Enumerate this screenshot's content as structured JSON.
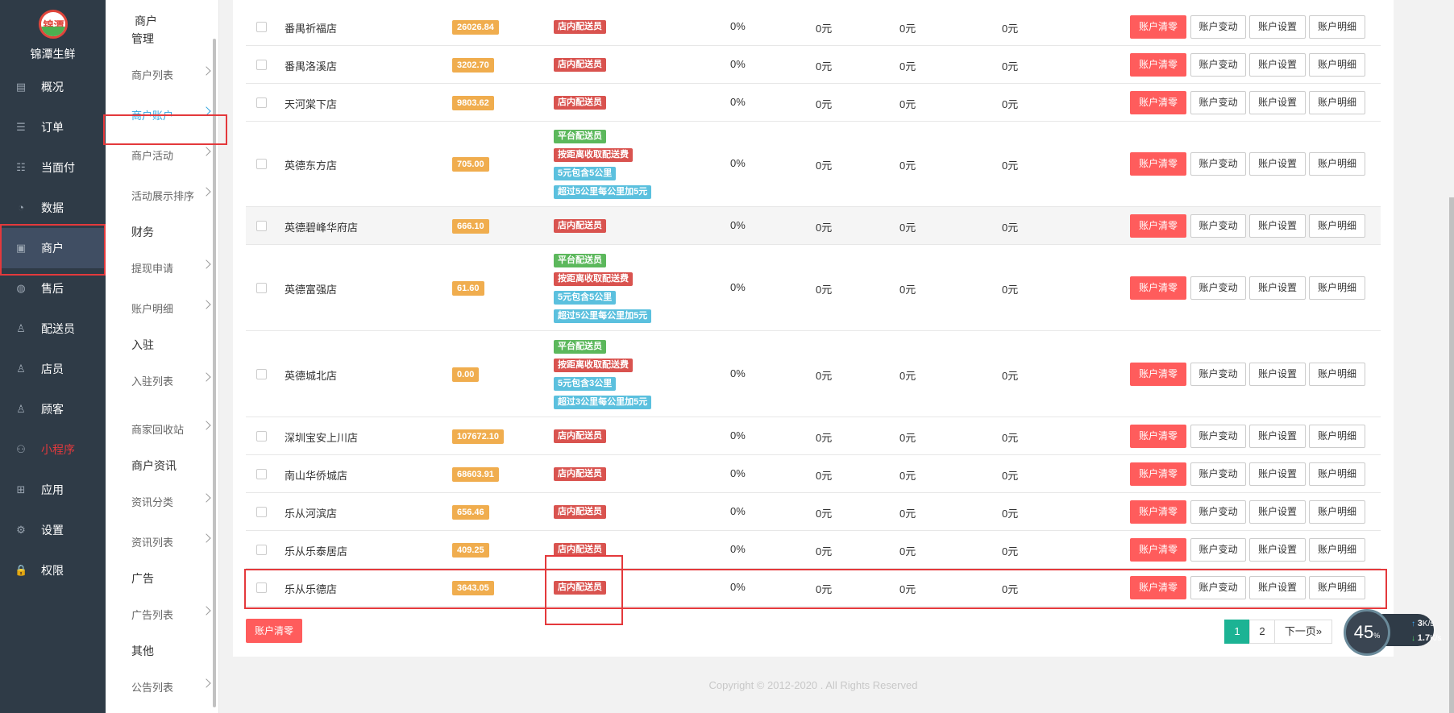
{
  "app": {
    "name": "锦潭生鲜",
    "logo_text": "锦潭"
  },
  "nav": {
    "items": [
      {
        "label": "概况",
        "icon": "dashboard-icon"
      },
      {
        "label": "订单",
        "icon": "order-icon"
      },
      {
        "label": "当面付",
        "icon": "payment-icon"
      },
      {
        "label": "数据",
        "icon": "chart-icon"
      },
      {
        "label": "商户",
        "icon": "store-icon"
      },
      {
        "label": "售后",
        "icon": "after-sale-icon"
      },
      {
        "label": "配送员",
        "icon": "courier-icon"
      },
      {
        "label": "店员",
        "icon": "staff-icon"
      },
      {
        "label": "顾客",
        "icon": "customer-icon"
      },
      {
        "label": "小程序",
        "icon": "mini-program-icon"
      },
      {
        "label": "应用",
        "icon": "apps-icon"
      },
      {
        "label": "设置",
        "icon": "gear-icon"
      },
      {
        "label": "权限",
        "icon": "lock-icon"
      }
    ],
    "active": "商户"
  },
  "subnav": {
    "title": "商户",
    "items": [
      {
        "label": "管理"
      },
      {
        "label": "商户列表"
      },
      {
        "label": "商户账户"
      },
      {
        "label": "商户活动"
      },
      {
        "label": "活动展示排序"
      },
      {
        "label": "财务"
      },
      {
        "label": "提现申请"
      },
      {
        "label": "账户明细"
      },
      {
        "label": "入驻"
      },
      {
        "label": "入驻列表"
      },
      {
        "label": "商家回收站"
      },
      {
        "label": "商户资讯"
      },
      {
        "label": "资讯分类"
      },
      {
        "label": "资讯列表"
      },
      {
        "label": "广告"
      },
      {
        "label": "广告列表"
      },
      {
        "label": "其他"
      },
      {
        "label": "公告列表"
      }
    ],
    "active": "商户账户"
  },
  "table": {
    "actions": [
      "账户清零",
      "账户变动",
      "账户设置",
      "账户明细"
    ],
    "rows": [
      {
        "name": "番禺祈福店",
        "balance": "26026.84",
        "tags": [
          {
            "text": "店内配送员",
            "color": "red"
          }
        ],
        "v1": "0%",
        "v2": "0元",
        "v3": "0元",
        "v4": "0元"
      },
      {
        "name": "番禺洛溪店",
        "balance": "3202.70",
        "tags": [
          {
            "text": "店内配送员",
            "color": "red"
          }
        ],
        "v1": "0%",
        "v2": "0元",
        "v3": "0元",
        "v4": "0元"
      },
      {
        "name": "天河棠下店",
        "balance": "9803.62",
        "tags": [
          {
            "text": "店内配送员",
            "color": "red"
          }
        ],
        "v1": "0%",
        "v2": "0元",
        "v3": "0元",
        "v4": "0元"
      },
      {
        "name": "英德东方店",
        "balance": "705.00",
        "tags": [
          {
            "text": "平台配送员",
            "color": "green"
          },
          {
            "text": "按距离收取配送费",
            "color": "red"
          },
          {
            "text": "5元包含5公里",
            "color": "blue"
          },
          {
            "text": "超过5公里每公里加5元",
            "color": "blue"
          }
        ],
        "v1": "0%",
        "v2": "0元",
        "v3": "0元",
        "v4": "0元"
      },
      {
        "name": "英德碧峰华府店",
        "balance": "666.10",
        "tags": [
          {
            "text": "店内配送员",
            "color": "red"
          }
        ],
        "v1": "0%",
        "v2": "0元",
        "v3": "0元",
        "v4": "0元"
      },
      {
        "name": "英德富强店",
        "balance": "61.60",
        "tags": [
          {
            "text": "平台配送员",
            "color": "green"
          },
          {
            "text": "按距离收取配送费",
            "color": "red"
          },
          {
            "text": "5元包含5公里",
            "color": "blue"
          },
          {
            "text": "超过5公里每公里加5元",
            "color": "blue"
          }
        ],
        "v1": "0%",
        "v2": "0元",
        "v3": "0元",
        "v4": "0元"
      },
      {
        "name": "英德城北店",
        "balance": "0.00",
        "tags": [
          {
            "text": "平台配送员",
            "color": "green"
          },
          {
            "text": "按距离收取配送费",
            "color": "red"
          },
          {
            "text": "5元包含3公里",
            "color": "blue"
          },
          {
            "text": "超过3公里每公里加5元",
            "color": "blue"
          }
        ],
        "v1": "0%",
        "v2": "0元",
        "v3": "0元",
        "v4": "0元"
      },
      {
        "name": "深圳宝安上川店",
        "balance": "107672.10",
        "tags": [
          {
            "text": "店内配送员",
            "color": "red"
          }
        ],
        "v1": "0%",
        "v2": "0元",
        "v3": "0元",
        "v4": "0元"
      },
      {
        "name": "南山华侨城店",
        "balance": "68603.91",
        "tags": [
          {
            "text": "店内配送员",
            "color": "red"
          }
        ],
        "v1": "0%",
        "v2": "0元",
        "v3": "0元",
        "v4": "0元"
      },
      {
        "name": "乐从河滨店",
        "balance": "656.46",
        "tags": [
          {
            "text": "店内配送员",
            "color": "red"
          }
        ],
        "v1": "0%",
        "v2": "0元",
        "v3": "0元",
        "v4": "0元"
      },
      {
        "name": "乐从乐泰居店",
        "balance": "409.25",
        "tags": [
          {
            "text": "店内配送员",
            "color": "red"
          }
        ],
        "v1": "0%",
        "v2": "0元",
        "v3": "0元",
        "v4": "0元"
      },
      {
        "name": "乐从乐德店",
        "balance": "3643.05",
        "tags": [
          {
            "text": "店内配送员",
            "color": "red"
          }
        ],
        "v1": "0%",
        "v2": "0元",
        "v3": "0元",
        "v4": "0元"
      }
    ]
  },
  "bulk_action": "账户清零",
  "pagination": {
    "pages": [
      "1",
      "2"
    ],
    "current": "1",
    "next": "下一页»"
  },
  "footer": "Copyright © 2012-2020 . All Rights Reserved",
  "speed_widget": {
    "percent": "45",
    "unit": "%",
    "up": "3",
    "up_unit": "K/s",
    "down": "1.7",
    "down_unit": "K/s"
  },
  "colors": {
    "sidebar": "#2f3b47",
    "active_link": "#2ea4e0",
    "danger": "#ff5c5c",
    "balance": "#f0ad4e",
    "tag_red": "#d9534f",
    "tag_green": "#5cb85c",
    "tag_blue": "#5bc0de",
    "page_active": "#1cb394",
    "highlight_box": "#e4393c"
  }
}
